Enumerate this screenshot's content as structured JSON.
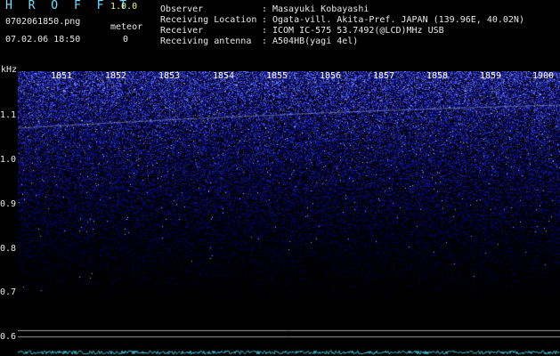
{
  "app": {
    "logo": "H R O F F T",
    "version": "1.0.0"
  },
  "file": {
    "name": "0702061850.png",
    "datetime": "07.02.06 18:50"
  },
  "meteor": {
    "label": "meteor",
    "count": "0"
  },
  "meta": [
    {
      "key": "Observer",
      "value": "Masayuki Kobayashi"
    },
    {
      "key": "Receiving Location",
      "value": "Ogata-vill. Akita-Pref. JAPAN (139.96E, 40.02N)"
    },
    {
      "key": "Receiver",
      "value": "ICOM IC-575 53.7492(@LCD)MHz USB"
    },
    {
      "key": "Receiving antenna",
      "value": "A504HB(yagi 4el)"
    }
  ],
  "axis": {
    "unit": "kHz",
    "y_ticks": [
      "1.1",
      "1.0",
      "0.9",
      "0.8",
      "0.7",
      "0.6"
    ],
    "x_ticks": [
      "1851",
      "1852",
      "1853",
      "1854",
      "1855",
      "1856",
      "1857",
      "1858",
      "1859",
      "1900"
    ]
  },
  "colors": {
    "noise_dark": "#0a0a5a",
    "noise_mid": "#2a3bd8",
    "noise_bright": "#8fa8ff",
    "carrier": "#b9c8ff",
    "logo": "#6fe0ff"
  }
}
